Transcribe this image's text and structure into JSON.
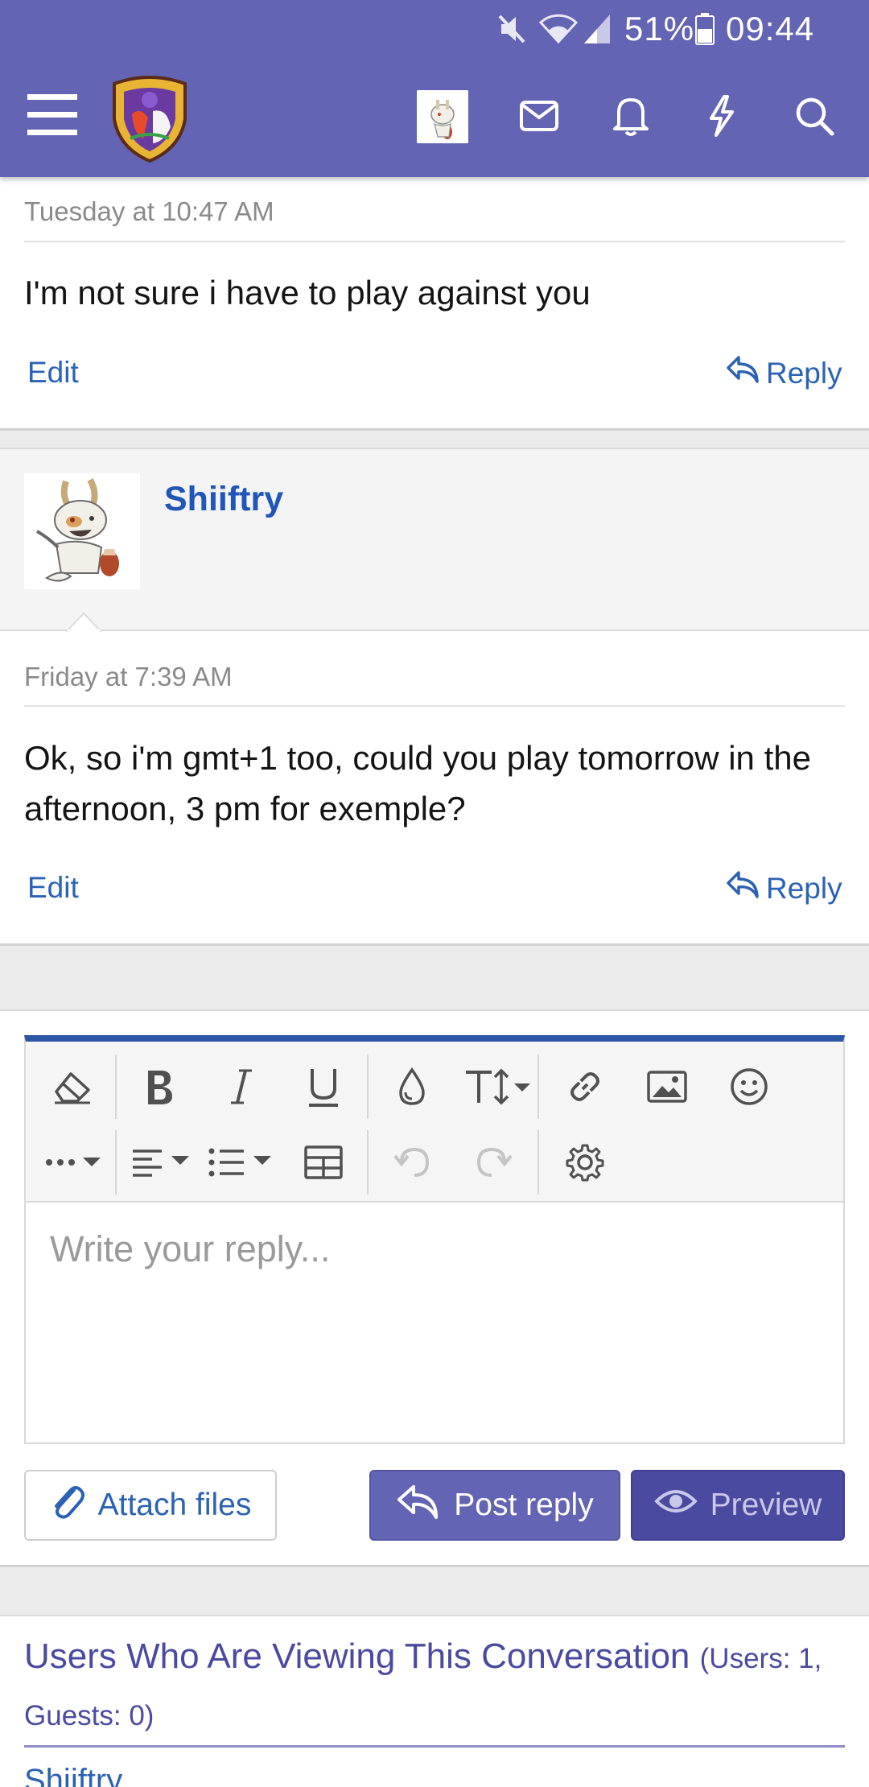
{
  "status_bar": {
    "battery": "51%",
    "time": "09:44"
  },
  "header": {
    "icons": [
      "menu-icon",
      "logo",
      "avatar",
      "mail-icon",
      "bell-icon",
      "lightning-icon",
      "search-icon"
    ],
    "color": "#6464b4"
  },
  "messages": [
    {
      "date": "Tuesday at 10:47 AM",
      "text": "I'm not sure i have to play against you",
      "edit_label": "Edit",
      "reply_label": "Reply"
    },
    {
      "username": "Shiiftry",
      "date": "Friday at 7:39 AM",
      "text": "Ok, so i'm gmt+1 too, could you play tomorrow in the afternoon, 3 pm for exemple?",
      "edit_label": "Edit",
      "reply_label": "Reply"
    }
  ],
  "editor": {
    "placeholder": "Write your reply...",
    "toolbar_row1": [
      "eraser-icon",
      "bold-icon",
      "italic-icon",
      "underline-icon",
      "color-drop-icon",
      "text-size-icon",
      "link-icon",
      "image-icon",
      "smiley-icon"
    ],
    "toolbar_row2": [
      "more-icon",
      "align-icon",
      "list-icon",
      "table-icon",
      "undo-icon",
      "redo-icon",
      "settings-icon"
    ],
    "accent": "#2e56a6"
  },
  "actions": {
    "attach_label": "Attach files",
    "post_label": "Post reply",
    "preview_label": "Preview"
  },
  "viewing": {
    "title": "Users Who Are Viewing This Conversation",
    "count": "(Users: 1, Guests: 0)",
    "first_user": "Shiiftry"
  }
}
